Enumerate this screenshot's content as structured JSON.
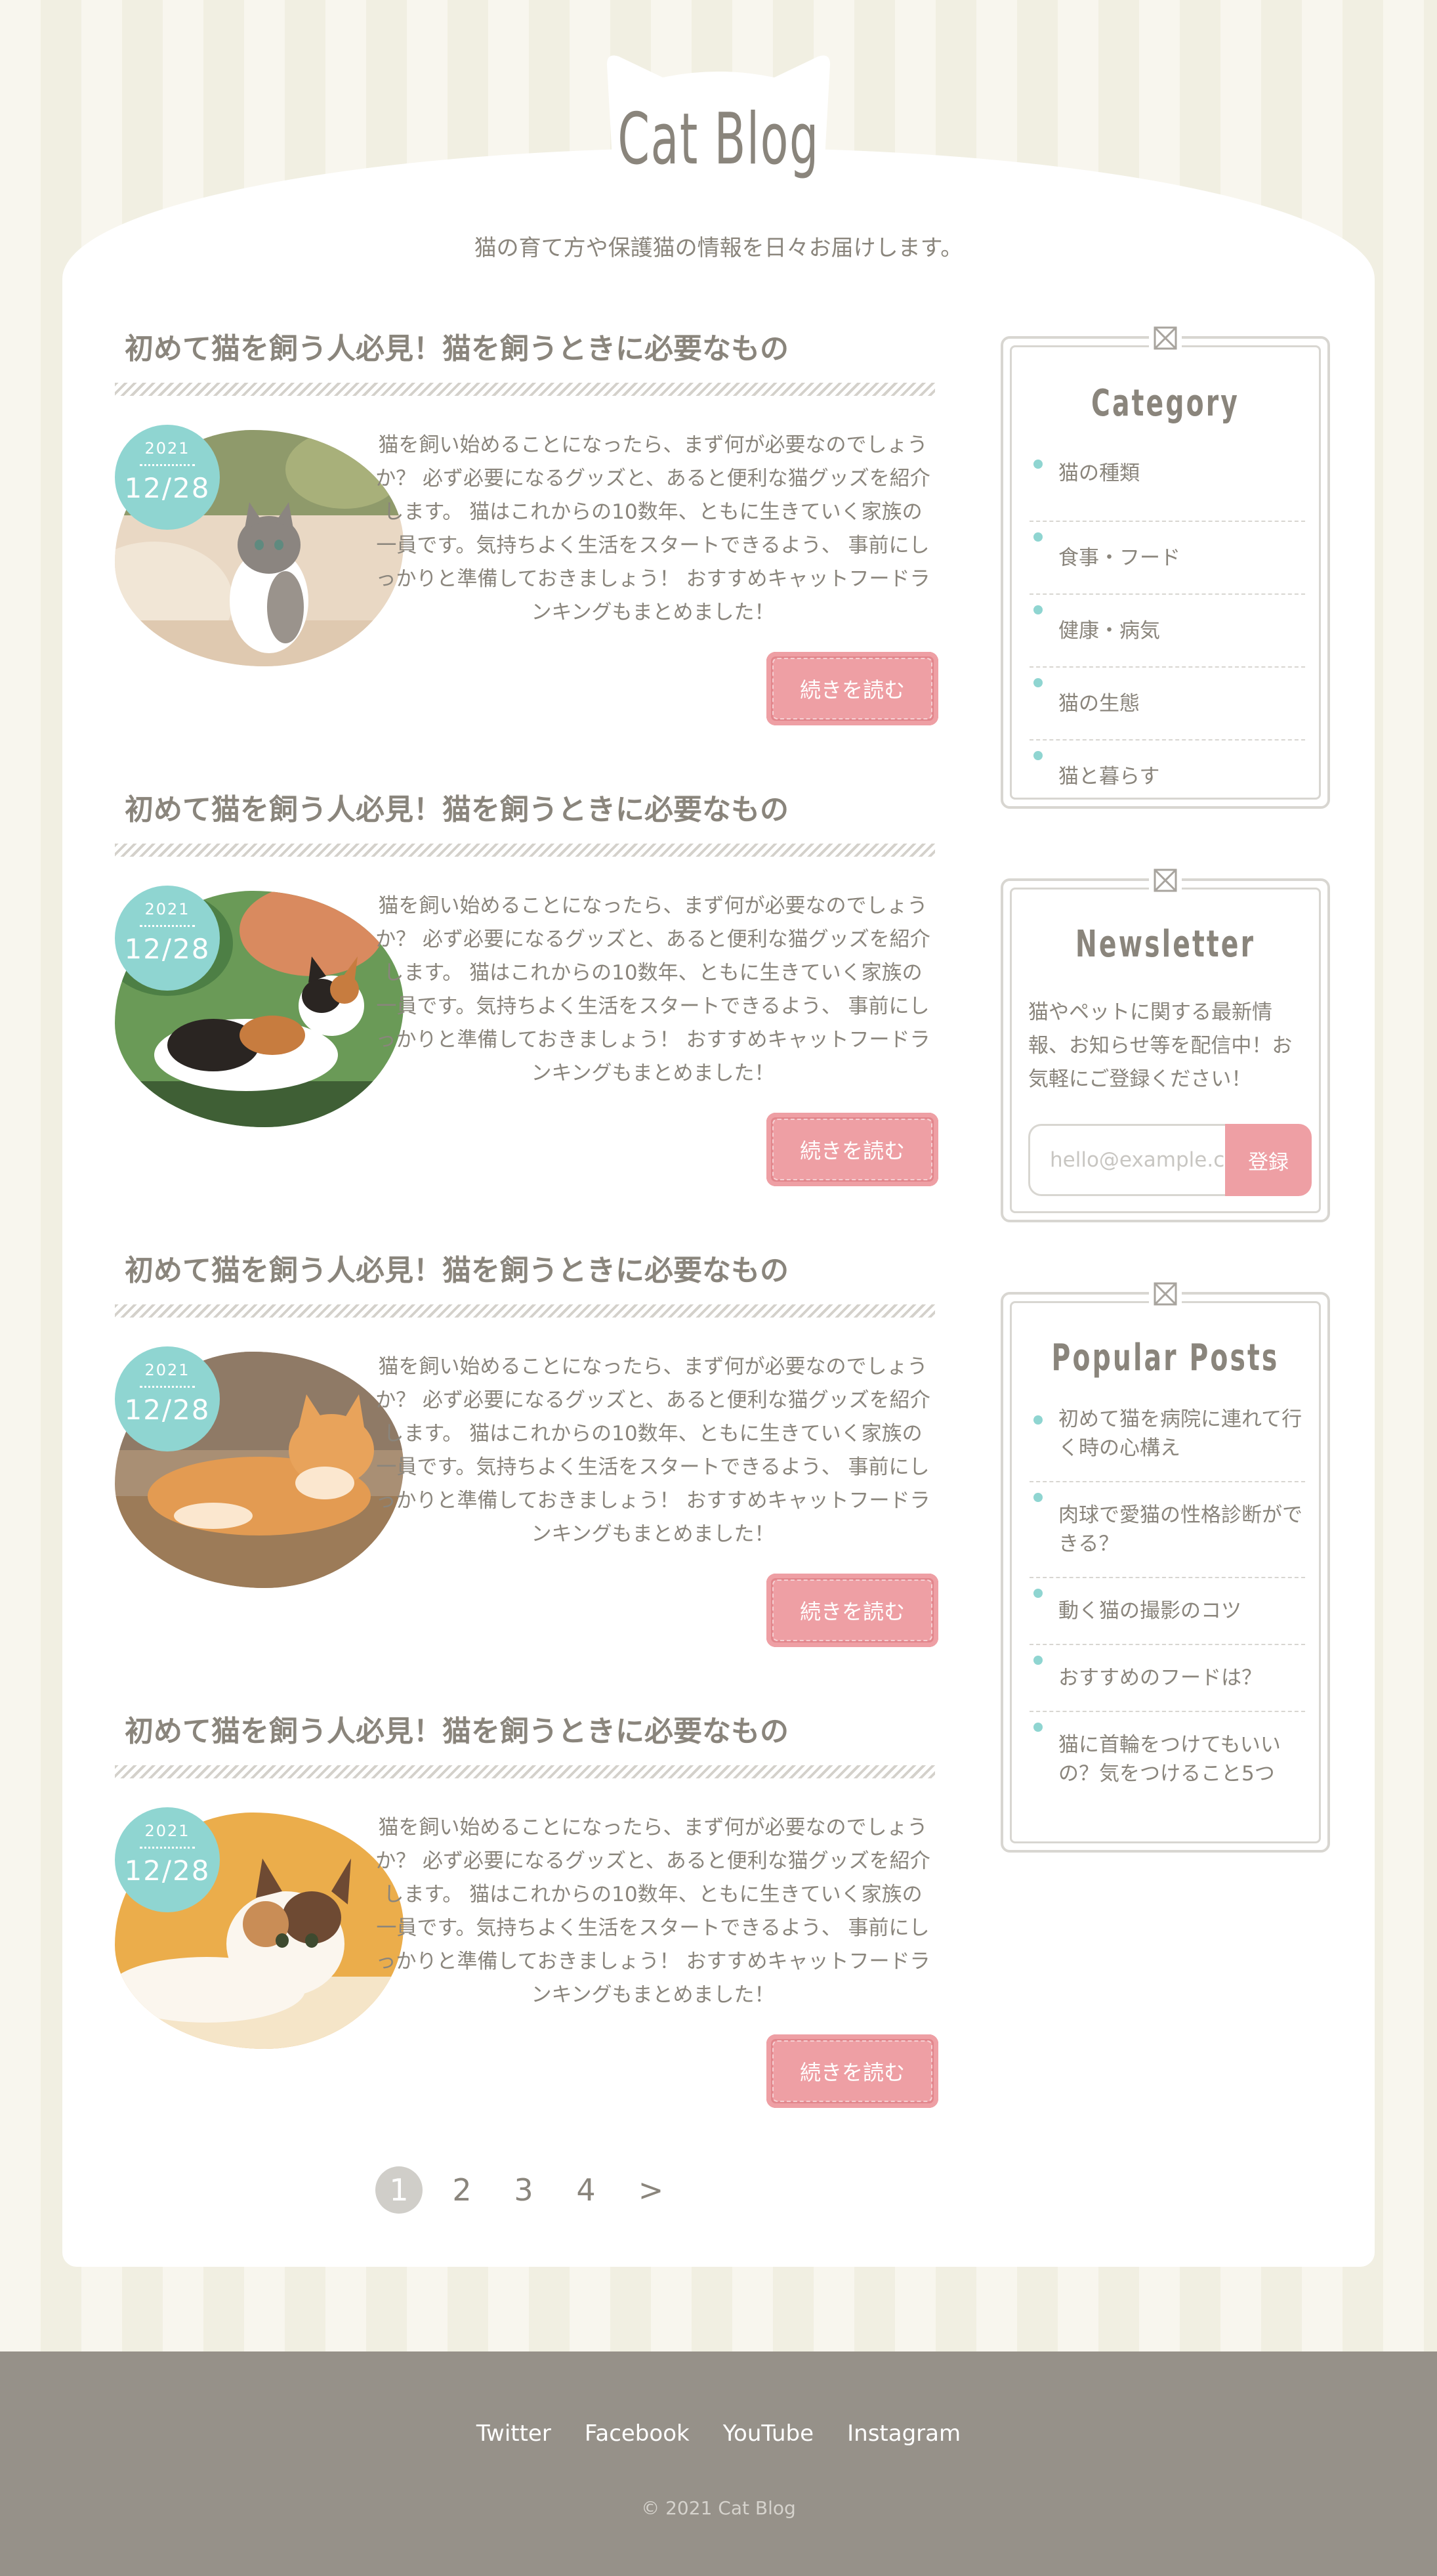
{
  "site": {
    "title": "Cat Blog",
    "tagline": "猫の育て方や保護猫の情報を日々お届けします。"
  },
  "posts": [
    {
      "title": "初めて猫を飼う人必見！猫を飼うときに必要なもの",
      "date_year": "2021",
      "date_day": "12/28",
      "excerpt": "猫を飼い始めることになったら、まず何が必要なのでしょうか？ 必ず必要になるグッズと、あると便利な猫グッズを紹介します。 猫はこれからの10数年、ともに生きていく家族の一員です。気持ちよく生活をスタートできるよう、 事前にしっかりと準備しておきましょう！ おすすめキャットフードランキングもまとめました！",
      "read_more": "続きを読む"
    },
    {
      "title": "初めて猫を飼う人必見！猫を飼うときに必要なもの",
      "date_year": "2021",
      "date_day": "12/28",
      "excerpt": "猫を飼い始めることになったら、まず何が必要なのでしょうか？ 必ず必要になるグッズと、あると便利な猫グッズを紹介します。 猫はこれからの10数年、ともに生きていく家族の一員です。気持ちよく生活をスタートできるよう、 事前にしっかりと準備しておきましょう！ おすすめキャットフードランキングもまとめました！",
      "read_more": "続きを読む"
    },
    {
      "title": "初めて猫を飼う人必見！猫を飼うときに必要なもの",
      "date_year": "2021",
      "date_day": "12/28",
      "excerpt": "猫を飼い始めることになったら、まず何が必要なのでしょうか？ 必ず必要になるグッズと、あると便利な猫グッズを紹介します。 猫はこれからの10数年、ともに生きていく家族の一員です。気持ちよく生活をスタートできるよう、 事前にしっかりと準備しておきましょう！ おすすめキャットフードランキングもまとめました！",
      "read_more": "続きを読む"
    },
    {
      "title": "初めて猫を飼う人必見！猫を飼うときに必要なもの",
      "date_year": "2021",
      "date_day": "12/28",
      "excerpt": "猫を飼い始めることになったら、まず何が必要なのでしょうか？ 必ず必要になるグッズと、あると便利な猫グッズを紹介します。 猫はこれからの10数年、ともに生きていく家族の一員です。気持ちよく生活をスタートできるよう、 事前にしっかりと準備しておきましょう！ おすすめキャットフードランキングもまとめました！",
      "read_more": "続きを読む"
    }
  ],
  "pagination": {
    "pages": [
      "1",
      "2",
      "3",
      "4"
    ],
    "current": "1",
    "next": ">"
  },
  "sidebar": {
    "category": {
      "title": "Category",
      "items": [
        "猫の種類",
        "食事・フード",
        "健康・病気",
        "猫の生態",
        "猫と暮らす"
      ]
    },
    "newsletter": {
      "title": "Newsletter",
      "text": "猫やペットに関する最新情報、お知らせ等を配信中！お気軽にご登録ください！",
      "placeholder": "hello@example.com",
      "button": "登録"
    },
    "popular": {
      "title": "Popular Posts",
      "items": [
        "初めて猫を病院に連れて行く時の心構え",
        "肉球で愛猫の性格診断ができる？",
        "動く猫の撮影のコツ",
        "おすすめのフードは？",
        "猫に首輪をつけてもいいの？気をつけること5つ"
      ]
    }
  },
  "footer": {
    "links": [
      "Twitter",
      "Facebook",
      "YouTube",
      "Instagram"
    ],
    "copyright": "© 2021 Cat Blog"
  },
  "colors": {
    "accent_teal": "#8fd5d1",
    "accent_pink": "#ee9fa4",
    "text": "#8a857c",
    "footer_bg": "#969189"
  }
}
